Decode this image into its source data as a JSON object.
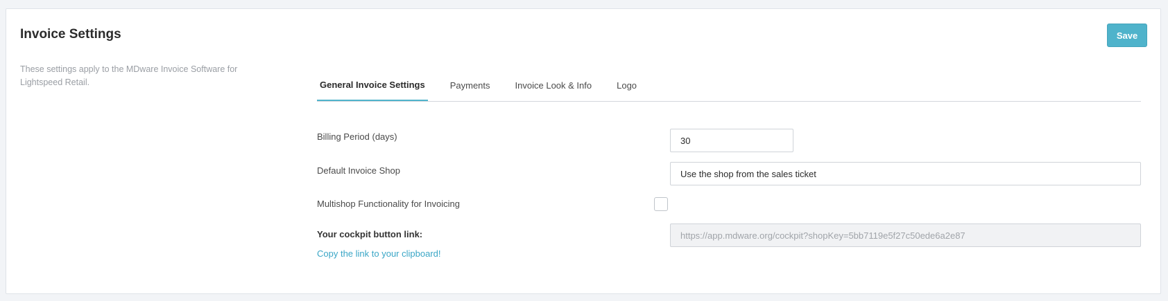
{
  "header": {
    "title": "Invoice Settings",
    "save_label": "Save"
  },
  "description": "These settings apply to the MDware Invoice Software for Lightspeed Retail.",
  "tabs": [
    {
      "label": "General Invoice Settings",
      "active": true
    },
    {
      "label": "Payments",
      "active": false
    },
    {
      "label": "Invoice Look & Info",
      "active": false
    },
    {
      "label": "Logo",
      "active": false
    }
  ],
  "form": {
    "billing_period": {
      "label": "Billing Period (days)",
      "value": "30"
    },
    "default_shop": {
      "label": "Default Invoice Shop",
      "value": "Use the shop from the sales ticket"
    },
    "multishop": {
      "label": "Multishop Functionality for Invoicing",
      "checked": false
    },
    "cockpit": {
      "label": "Your cockpit button link:",
      "value": "https://app.mdware.org/cockpit?shopKey=5bb7119e5f27c50ede6a2e87",
      "copy_label": "Copy the link to your clipboard!"
    }
  },
  "colors": {
    "accent": "#4fb3cb",
    "link": "#3aa6c6",
    "background": "#f2f4f7"
  }
}
